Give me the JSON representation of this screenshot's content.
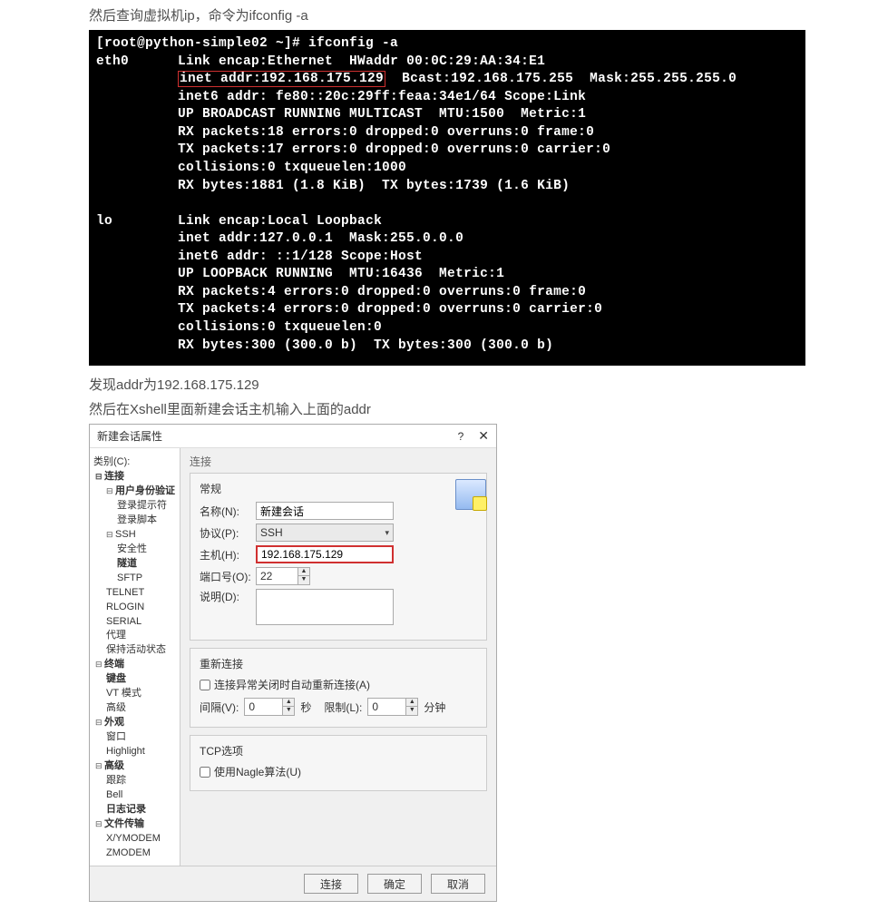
{
  "doc": {
    "line1": "然后查询虚拟机ip，命令为ifconfig -a",
    "found_addr": "发现addr为192.168.175.129",
    "xshell_line": "然后在Xshell里面新建会话主机输入上面的addr"
  },
  "terminal": {
    "prompt": "[root@python-simple02 ~]# ifconfig -a",
    "eth0_label": "eth0",
    "eth0_l1": "Link encap:Ethernet  HWaddr 00:0C:29:AA:34:E1",
    "eth0_hl": "inet addr:192.168.175.129",
    "eth0_l2_rest": "  Bcast:192.168.175.255  Mask:255.255.255.0",
    "eth0_l3": "inet6 addr: fe80::20c:29ff:feaa:34e1/64 Scope:Link",
    "eth0_l4": "UP BROADCAST RUNNING MULTICAST  MTU:1500  Metric:1",
    "eth0_l5": "RX packets:18 errors:0 dropped:0 overruns:0 frame:0",
    "eth0_l6": "TX packets:17 errors:0 dropped:0 overruns:0 carrier:0",
    "eth0_l7": "collisions:0 txqueuelen:1000",
    "eth0_l8": "RX bytes:1881 (1.8 KiB)  TX bytes:1739 (1.6 KiB)",
    "lo_label": "lo",
    "lo_l1": "Link encap:Local Loopback",
    "lo_l2": "inet addr:127.0.0.1  Mask:255.0.0.0",
    "lo_l3": "inet6 addr: ::1/128 Scope:Host",
    "lo_l4": "UP LOOPBACK RUNNING  MTU:16436  Metric:1",
    "lo_l5": "RX packets:4 errors:0 dropped:0 overruns:0 frame:0",
    "lo_l6": "TX packets:4 errors:0 dropped:0 overruns:0 carrier:0",
    "lo_l7": "collisions:0 txqueuelen:0",
    "lo_l8": "RX bytes:300 (300.0 b)  TX bytes:300 (300.0 b)"
  },
  "dialog": {
    "title": "新建会话属性",
    "help": "?",
    "close": "✕",
    "category_label": "类别(C):",
    "tree": {
      "n0": "连接",
      "n1": "用户身份验证",
      "n1a": "登录提示符",
      "n1b": "登录脚本",
      "n2": "SSH",
      "n2a": "安全性",
      "n2b": "隧道",
      "n2c": "SFTP",
      "n3": "TELNET",
      "n4": "RLOGIN",
      "n5": "SERIAL",
      "n6": "代理",
      "n7": "保持活动状态",
      "t0": "终端",
      "t1": "键盘",
      "t2": "VT 模式",
      "t3": "高级",
      "a0": "外观",
      "a1": "窗口",
      "a2": "Highlight",
      "g0": "高级",
      "g1": "跟踪",
      "g2": "Bell",
      "g3": "日志记录",
      "f0": "文件传输",
      "f1": "X/YMODEM",
      "f2": "ZMODEM"
    },
    "right_header": "连接",
    "general": {
      "header": "常规",
      "name_label": "名称(N):",
      "name_value": "新建会话",
      "proto_label": "协议(P):",
      "proto_value": "SSH",
      "host_label": "主机(H):",
      "host_value": "192.168.175.129",
      "port_label": "端口号(O):",
      "port_value": "22",
      "desc_label": "说明(D):"
    },
    "reconnect": {
      "header": "重新连接",
      "chk_label": "连接异常关闭时自动重新连接(A)",
      "interval_label": "间隔(V):",
      "interval_value": "0",
      "sec_label": "秒",
      "limit_label": "限制(L):",
      "limit_value": "0",
      "min_label": "分钟"
    },
    "tcp": {
      "header": "TCP选项",
      "nagle_label": "使用Nagle算法(U)"
    },
    "buttons": {
      "connect": "连接",
      "ok": "确定",
      "cancel": "取消"
    }
  }
}
